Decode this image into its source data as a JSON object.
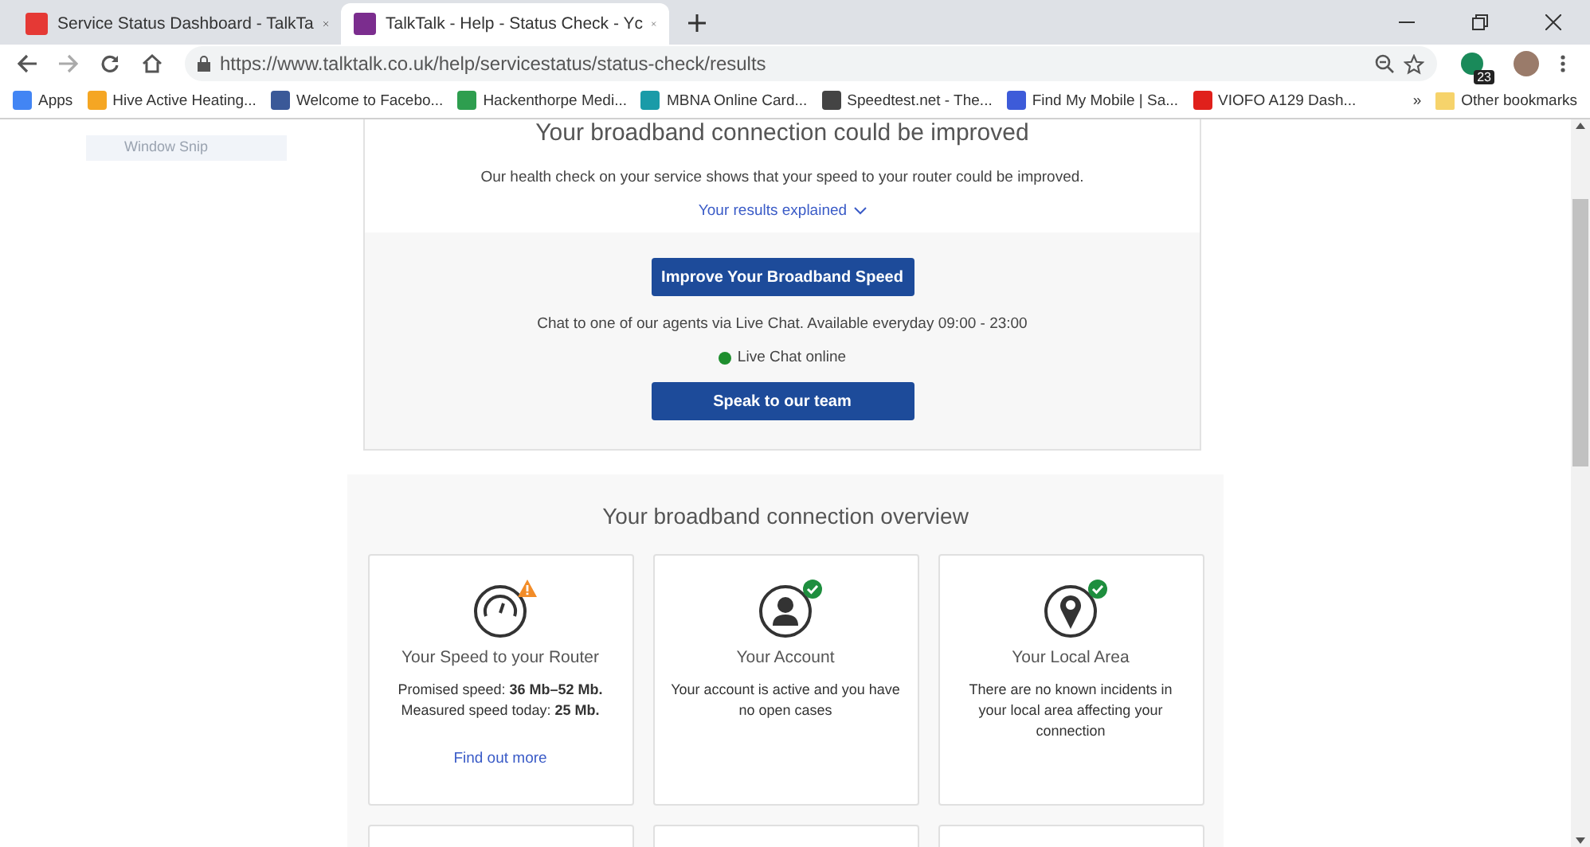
{
  "browser": {
    "tabs": [
      {
        "title": "Service Status Dashboard - TalkTa",
        "selected": false,
        "color": "#e53935"
      },
      {
        "title": "TalkTalk - Help - Status Check - Yc",
        "selected": true,
        "color": "#7b2d8e"
      }
    ],
    "address": "https://www.talktalk.co.uk/help/servicestatus/status-check/results",
    "extension_badge": "23",
    "bookmarks": [
      {
        "label": "Apps",
        "color": "#4285f4"
      },
      {
        "label": "Hive Active Heating...",
        "color": "#f5a623"
      },
      {
        "label": "Welcome to Facebo...",
        "color": "#3b5998"
      },
      {
        "label": "Hackenthorpe Medi...",
        "color": "#2e9e4f"
      },
      {
        "label": "MBNA Online Card...",
        "color": "#1a9ba8"
      },
      {
        "label": "Speedtest.net - The...",
        "color": "#444444"
      },
      {
        "label": "Find My Mobile | Sa...",
        "color": "#3d5bd9"
      },
      {
        "label": "VIOFO A129 Dash...",
        "color": "#e0201b"
      }
    ],
    "overflow": "»",
    "other_bookmarks": "Other bookmarks"
  },
  "snip_overlay": {
    "label": "Window Snip"
  },
  "result": {
    "title": "Your broadband connection could be improved",
    "message": "Our health check on your service shows that your speed to your router could be improved.",
    "explain_link": "Your results explained",
    "improve_button": "Improve Your Broadband Speed",
    "chat_text": "Chat to one of our agents via Live Chat. Available everyday 09:00 - 23:00",
    "chat_status": {
      "label": "Live Chat online",
      "color": "#1e8e2e"
    },
    "team_button": "Speak to our team"
  },
  "overview": {
    "title": "Your broadband connection overview",
    "cards": [
      {
        "title": "Your Speed to your Router",
        "kind": "warning",
        "lines": [
          "Promised speed: **36 Mb–52 Mb.**",
          "Measured speed today: **25 Mb.**"
        ],
        "link": "Find out more"
      },
      {
        "title": "Your Account",
        "kind": "ok",
        "lines": [
          "Your account is active and you have no open cases"
        ]
      },
      {
        "title": "Your Local Area",
        "kind": "ok",
        "lines": [
          "There are no known incidents in your local area affecting your connection"
        ]
      }
    ]
  }
}
